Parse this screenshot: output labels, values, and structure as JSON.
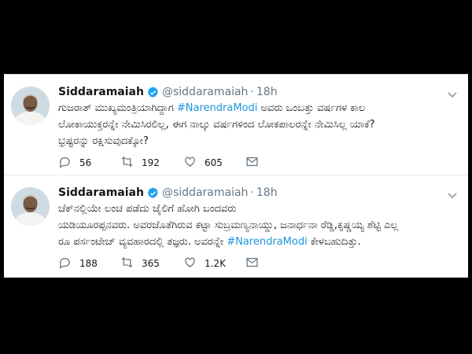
{
  "tweets": [
    {
      "name": "Siddaramaiah",
      "handle": "@siddaramaiah",
      "separator": "·",
      "time": "18h",
      "lines": [
        {
          "pre": "ಗುಜರಾತ್ ಮುಖ್ಯಮಂತ್ರಿಯಾಗಿದ್ದಾಗ ",
          "tag": "#NarendraModi",
          "post": " ಅವರು ಒಂಬತ್ತು ವರ್ಷಗಳ ಕಾಲ"
        },
        {
          "pre": "ಲೋಕಾಯುಕ್ತರನ್ನೇ ನೇಮಿಸಿರಲಿಲ್ಲ, ಈಗ ನಾಲ್ಕು ವರ್ಷಗಳಿಂದ ಲೋಕಪಾಲರನ್ನೇ ನೇಮಿಸಿಲ್ಲ ಯಾಕೆ?",
          "tag": "",
          "post": ""
        },
        {
          "pre": "ಭ್ರಷ್ಟರನ್ನು ರಕ್ಷಿಸುವುದಕ್ಕೋ?",
          "tag": "",
          "post": ""
        }
      ],
      "replies": "56",
      "retweets": "192",
      "likes": "605"
    },
    {
      "name": "Siddaramaiah",
      "handle": "@siddaramaiah",
      "separator": "·",
      "time": "18h",
      "lines": [
        {
          "pre": "ಚೆಕ್‌ನಲ್ಲಿಯೇ ಲಂಚ ಪಡೆದು ಜೈಲಿಗೆ ಹೋಗಿ ಬಂದವರು",
          "tag": "",
          "post": ""
        },
        {
          "pre": "ಯಡಿಯೂರಪ್ಪನವರು. ಅವರಜೊತೆಗಿರುವ ಕಟ್ಟಾ ಸುಬ್ರಮಣ್ಯನಾಯ್ಡು, ಜನಾರ್ಧನಾ ರೆಡ್ಡಿ,ಕೃಷ್ಣಯ್ಯ ಶೆಟ್ಟಿ ಎಲ್ಲ",
          "tag": "",
          "post": ""
        },
        {
          "pre": "ರೂ ಪರ್ಸಂಟೇಜ್ ವ್ಯವಹಾರದಲ್ಲಿ ತಜ್ಞರು. ಅವರನ್ನೇ ",
          "tag": "#NarendraModi",
          "post": " ಕೇಳಬಹುದಿತ್ತು."
        }
      ],
      "replies": "188",
      "retweets": "365",
      "likes": "1.2K"
    }
  ],
  "colors": {
    "hashtag": "#1b95e0",
    "verified": "#1da1f2",
    "muted": "#657786",
    "text": "#14171a"
  }
}
